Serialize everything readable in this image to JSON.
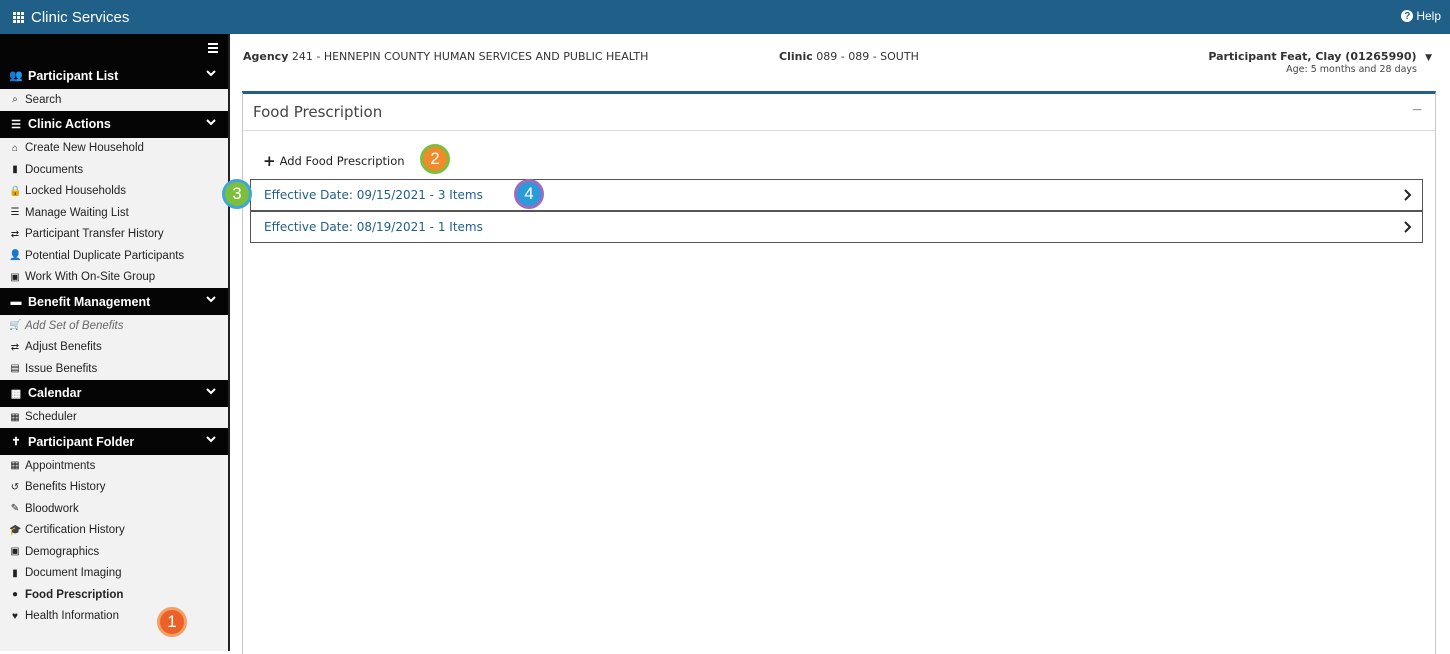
{
  "app": {
    "title": "Clinic Services",
    "help_label": "Help"
  },
  "sidebar": {
    "sections": [
      {
        "title": "Participant List",
        "icon": "users-icon",
        "items": [
          {
            "label": "Search",
            "icon": "search-icon"
          }
        ]
      },
      {
        "title": "Clinic Actions",
        "icon": "tasks-icon",
        "items": [
          {
            "label": "Create New Household",
            "icon": "home-icon"
          },
          {
            "label": "Documents",
            "icon": "file-icon"
          },
          {
            "label": "Locked Households",
            "icon": "lock-icon"
          },
          {
            "label": "Manage Waiting List",
            "icon": "list-icon"
          },
          {
            "label": "Participant Transfer History",
            "icon": "transfer-icon"
          },
          {
            "label": "Potential Duplicate Participants",
            "icon": "user-edit-icon"
          },
          {
            "label": "Work With On-Site Group",
            "icon": "group-icon"
          }
        ]
      },
      {
        "title": "Benefit Management",
        "icon": "card-icon",
        "items": [
          {
            "label": "Add Set of Benefits",
            "icon": "cart-icon"
          },
          {
            "label": "Adjust Benefits",
            "icon": "transfer-icon"
          },
          {
            "label": "Issue Benefits",
            "icon": "card-icon"
          }
        ]
      },
      {
        "title": "Calendar",
        "icon": "calendar-icon",
        "items": [
          {
            "label": "Scheduler",
            "icon": "calendar-icon"
          }
        ]
      },
      {
        "title": "Participant Folder",
        "icon": "child-icon",
        "items": [
          {
            "label": "Appointments",
            "icon": "calendar-icon"
          },
          {
            "label": "Benefits History",
            "icon": "history-icon"
          },
          {
            "label": "Bloodwork",
            "icon": "eyedropper-icon"
          },
          {
            "label": "Certification History",
            "icon": "graduation-cap-icon"
          },
          {
            "label": "Demographics",
            "icon": "id-card-icon"
          },
          {
            "label": "Document Imaging",
            "icon": "document-icon"
          },
          {
            "label": "Food Prescription",
            "icon": "apple-icon"
          },
          {
            "label": "Health Information",
            "icon": "heartbeat-icon"
          }
        ]
      }
    ]
  },
  "header": {
    "agency_label": "Agency",
    "agency_value": "241 - HENNEPIN COUNTY HUMAN SERVICES AND PUBLIC HEALTH",
    "clinic_label": "Clinic",
    "clinic_value": "089 - 089 - SOUTH",
    "participant_label": "Participant",
    "participant_value": "Feat, Clay (01265990)",
    "participant_age": "Age: 5 months and 28 days"
  },
  "panel": {
    "title": "Food Prescription",
    "collapse_label": "−",
    "add_label": "Add Food Prescription",
    "rows": [
      {
        "label": "Effective Date: 09/15/2021 - 3 Items"
      },
      {
        "label": "Effective Date: 08/19/2021 - 1 Items"
      }
    ]
  },
  "callouts": [
    "1",
    "2",
    "3",
    "4"
  ],
  "colors": {
    "brand": "#1f5f88",
    "sidebar_header": "#050505",
    "link": "#1f5f88"
  }
}
